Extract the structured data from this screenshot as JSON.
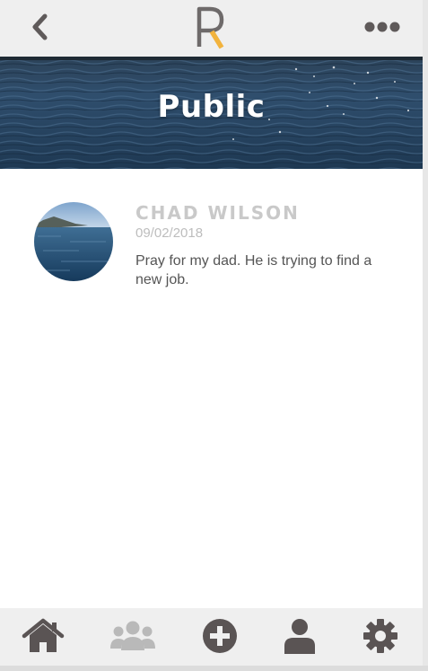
{
  "header": {
    "back_icon": "chevron-left-icon",
    "logo_letter": "R",
    "more_icon": "ellipsis-icon",
    "colors": {
      "logo_gray": "#6e6a6a",
      "logo_accent": "#f2b33d",
      "icon_gray": "#5f5a5a"
    }
  },
  "banner": {
    "title": "Public",
    "image": "ocean-water"
  },
  "post": {
    "author": "CHAD WILSON",
    "date": "09/02/2018",
    "message": "Pray for my dad. He is trying to find a new job.",
    "avatar": "ocean-coast-photo"
  },
  "bottom_nav": {
    "items": [
      {
        "name": "home",
        "icon": "home-icon",
        "active": true
      },
      {
        "name": "groups",
        "icon": "group-icon",
        "active": false
      },
      {
        "name": "add",
        "icon": "plus-circle-icon",
        "active": true
      },
      {
        "name": "profile",
        "icon": "person-icon",
        "active": true
      },
      {
        "name": "settings",
        "icon": "gear-icon",
        "active": true
      }
    ],
    "colors": {
      "active": "#5a5454",
      "inactive": "#b9b9b9"
    }
  }
}
